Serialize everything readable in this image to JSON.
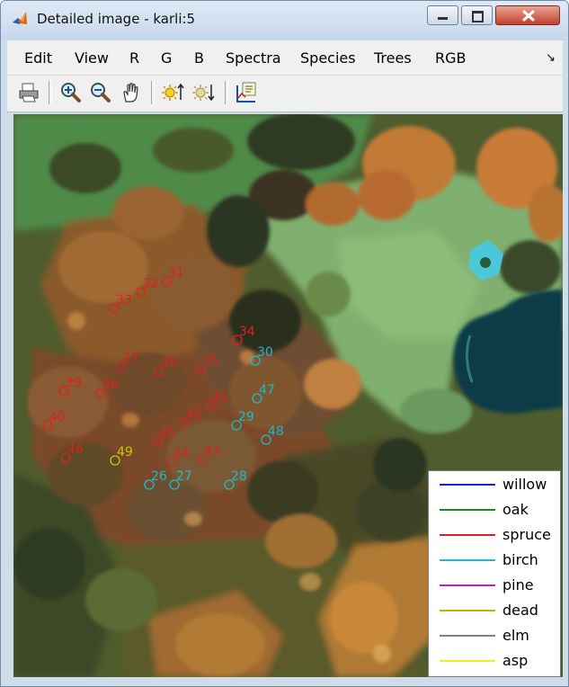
{
  "window": {
    "title": "Detailed image - karli:5",
    "min_icon": "minimize-icon",
    "max_icon": "maximize-icon",
    "close_icon": "close-icon"
  },
  "menu": [
    "Edit",
    "View",
    "R",
    "G",
    "B",
    "Spectra",
    "Species",
    "Trees",
    "RGB"
  ],
  "toolbar": [
    "print-icon",
    "zoom-in-icon",
    "zoom-out-icon",
    "pan-hand-icon",
    "brighten-icon",
    "darken-icon",
    "select-data-icon"
  ],
  "tree_markers": [
    {
      "id": "31",
      "species": "spruce"
    },
    {
      "id": "32",
      "species": "spruce"
    },
    {
      "id": "33",
      "species": "spruce"
    },
    {
      "id": "34",
      "species": "spruce"
    },
    {
      "id": "30",
      "species": "birch"
    },
    {
      "id": "37",
      "species": "spruce"
    },
    {
      "id": "36",
      "species": "spruce"
    },
    {
      "id": "35",
      "species": "spruce"
    },
    {
      "id": "39",
      "species": "spruce"
    },
    {
      "id": "38",
      "species": "spruce"
    },
    {
      "id": "47",
      "species": "birch"
    },
    {
      "id": "41",
      "species": "spruce"
    },
    {
      "id": "40",
      "species": "spruce"
    },
    {
      "id": "42",
      "species": "spruce"
    },
    {
      "id": "29",
      "species": "birch"
    },
    {
      "id": "48",
      "species": "birch"
    },
    {
      "id": "45",
      "species": "spruce"
    },
    {
      "id": "46",
      "species": "spruce"
    },
    {
      "id": "49",
      "species": "dead"
    },
    {
      "id": "44",
      "species": "spruce"
    },
    {
      "id": "43",
      "species": "spruce"
    },
    {
      "id": "26",
      "species": "birch"
    },
    {
      "id": "27",
      "species": "birch"
    },
    {
      "id": "28",
      "species": "birch"
    }
  ],
  "legend": [
    {
      "label": "willow",
      "color": "#1f1fd0"
    },
    {
      "label": "oak",
      "color": "#1a8a1a"
    },
    {
      "label": "spruce",
      "color": "#e02020"
    },
    {
      "label": "birch",
      "color": "#20b8c8"
    },
    {
      "label": "pine",
      "color": "#c020c0"
    },
    {
      "label": "dead",
      "color": "#b8b800"
    },
    {
      "label": "elm",
      "color": "#808080"
    },
    {
      "label": "asp",
      "color": "#f0f020"
    }
  ],
  "colors": {
    "spruce": "#e02020",
    "birch": "#20b8c8",
    "dead": "#c8c800"
  }
}
